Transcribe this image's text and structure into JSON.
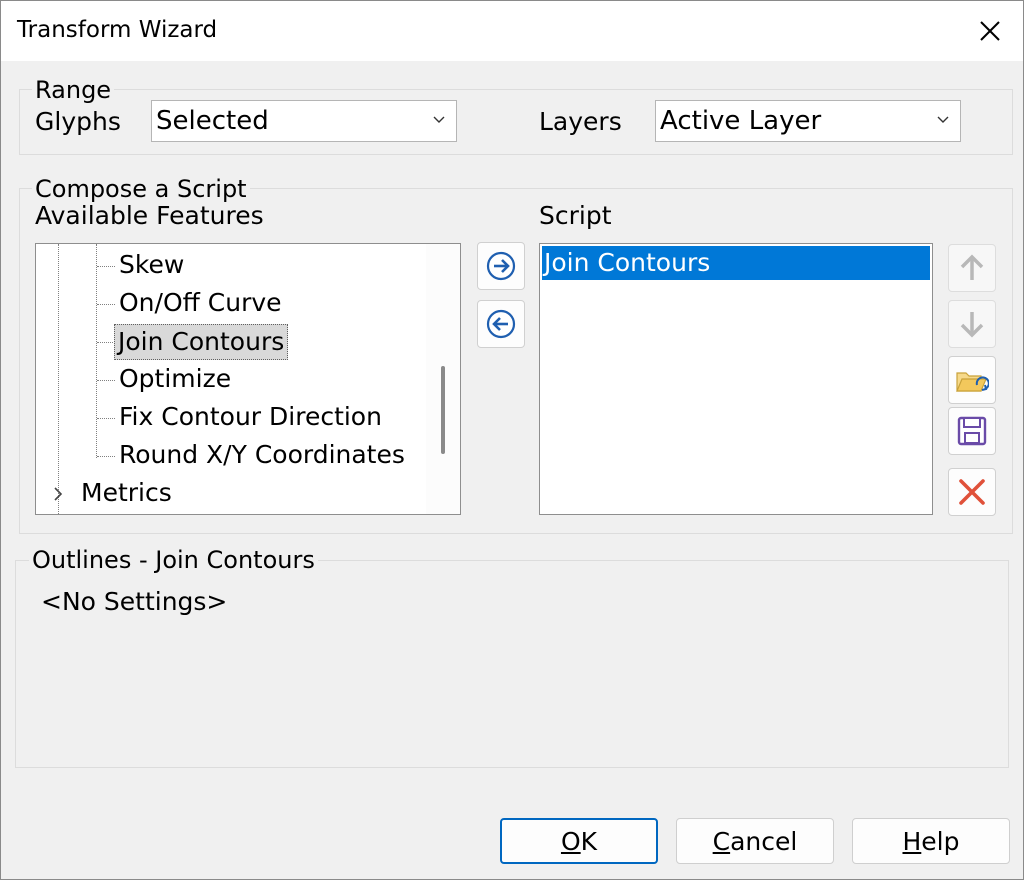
{
  "window": {
    "title": "Transform Wizard"
  },
  "range": {
    "group_label": "Range",
    "glyphs_label": "Glyphs",
    "glyphs_value": "Selected",
    "layers_label": "Layers",
    "layers_value": "Active Layer"
  },
  "compose": {
    "group_label": "Compose a Script",
    "available_label": "Available Features",
    "script_label": "Script",
    "features": [
      "Skew",
      "On/Off Curve",
      "Join Contours",
      "Optimize",
      "Fix Contour Direction",
      "Round X/Y Coordinates"
    ],
    "selected_feature": "Join Contours",
    "collapsed_node": "Metrics",
    "script_items": [
      "Join Contours"
    ]
  },
  "settings": {
    "group_label": "Outlines - Join Contours",
    "value": "<No Settings>"
  },
  "buttons": {
    "ok": {
      "u": "O",
      "rest": "K"
    },
    "cancel": {
      "u": "C",
      "rest": "ancel"
    },
    "help": {
      "u": "H",
      "rest": "elp"
    }
  },
  "icons": {
    "add": "arrow-right-circle-icon",
    "remove": "arrow-left-circle-icon",
    "up": "arrow-up-icon",
    "down": "arrow-down-icon",
    "open": "folder-open-icon",
    "save": "floppy-disk-icon",
    "delete": "red-x-icon",
    "close": "close-icon"
  },
  "colors": {
    "accent": "#0078d7",
    "arrow_blue": "#1f5fb0",
    "save_purple": "#6a4ba8",
    "delete_red": "#e0513a",
    "folder_yellow": "#f3c85c"
  }
}
